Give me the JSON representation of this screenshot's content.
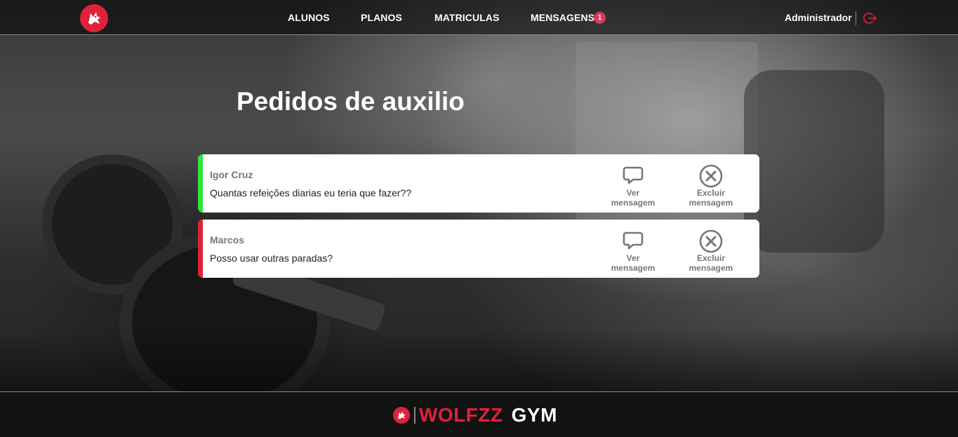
{
  "header": {
    "nav": [
      {
        "label": "ALUNOS"
      },
      {
        "label": "PLANOS"
      },
      {
        "label": "MATRICULAS"
      },
      {
        "label": "MENSAGENS"
      }
    ],
    "messages_badge": "1",
    "user_name": "Administrador",
    "logo_icon": "wolf-logo-icon",
    "logout_icon": "logout-icon"
  },
  "main": {
    "title": "Pedidos de auxilio",
    "requests": [
      {
        "name": "Igor Cruz",
        "message": "Quantas refeições diarias eu teria que fazer??",
        "stripe_color": "#2ee53a",
        "view_label_1": "Ver",
        "view_label_2": "mensagem",
        "delete_label_1": "Excluir",
        "delete_label_2": "mensagem"
      },
      {
        "name": "Marcos",
        "message": "Posso usar outras paradas?",
        "stripe_color": "#e0213a",
        "view_label_1": "Ver",
        "view_label_2": "mensagem",
        "delete_label_1": "Excluir",
        "delete_label_2": "mensagem"
      }
    ]
  },
  "footer": {
    "brand_primary": "WOLFZZ",
    "brand_secondary": "GYM"
  },
  "colors": {
    "accent": "#e0213a",
    "badge": "#d93a5c",
    "success_stripe": "#2ee53a"
  }
}
